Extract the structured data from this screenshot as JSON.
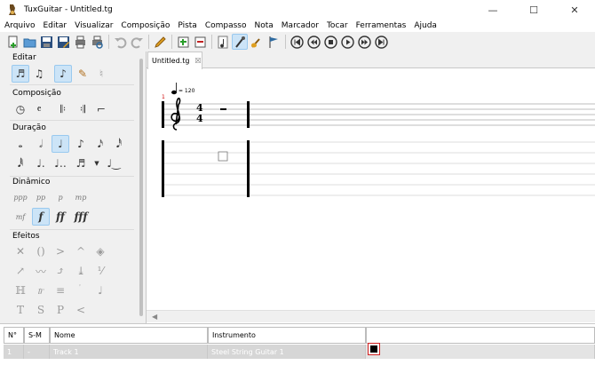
{
  "window": {
    "title": "TuxGuitar - Untitled.tg",
    "minimize": "—",
    "maximize": "☐",
    "close": "✕"
  },
  "menu": [
    "Arquivo",
    "Editar",
    "Visualizar",
    "Composição",
    "Pista",
    "Compasso",
    "Nota",
    "Marcador",
    "Tocar",
    "Ferramentas",
    "Ajuda"
  ],
  "toolbar": [
    {
      "icon": "new-file-icon"
    },
    {
      "icon": "open-file-icon"
    },
    {
      "icon": "save-icon"
    },
    {
      "icon": "save-as-icon"
    },
    {
      "icon": "print-icon"
    },
    {
      "icon": "print-preview-icon"
    },
    {
      "sep": true
    },
    {
      "icon": "undo-icon"
    },
    {
      "icon": "redo-icon"
    },
    {
      "sep": true
    },
    {
      "icon": "edit-pencil-icon"
    },
    {
      "sep": true
    },
    {
      "icon": "tracks-icon"
    },
    {
      "icon": "mixer-icon"
    },
    {
      "sep": true
    },
    {
      "icon": "score-view-icon"
    },
    {
      "icon": "tablature-view-icon",
      "active": true
    },
    {
      "icon": "guitar-icon"
    },
    {
      "icon": "flag-icon"
    },
    {
      "sep": true
    },
    {
      "icon": "first-icon"
    },
    {
      "icon": "rewind-icon"
    },
    {
      "icon": "stop-icon"
    },
    {
      "icon": "play-icon"
    },
    {
      "icon": "forward-icon"
    },
    {
      "icon": "last-icon"
    }
  ],
  "panel": {
    "editar": "Editar",
    "composicao": "Composição",
    "duracao": "Duração",
    "dinamico": "Dinâmico",
    "efeitos": "Efeitos",
    "dynamics": [
      "ppp",
      "pp",
      "p",
      "mp",
      "mf",
      "f",
      "ff",
      "fff"
    ]
  },
  "tab": {
    "label": "Untitled.tg",
    "close": "☒"
  },
  "score": {
    "measure_number": "1",
    "tempo": "= 120",
    "time_sig_top": "4",
    "time_sig_bottom": "4"
  },
  "tracks": {
    "headers": [
      "N°",
      "S-M",
      "Nome",
      "Instrumento"
    ],
    "rows": [
      {
        "number": "1",
        "sm": "-",
        "name": "Track 1",
        "instrument": "Steel String Guitar 1"
      }
    ]
  },
  "colors": {
    "accent": "#cce4f7",
    "track_border": "#d02020",
    "measure_number": "#cc0000"
  }
}
